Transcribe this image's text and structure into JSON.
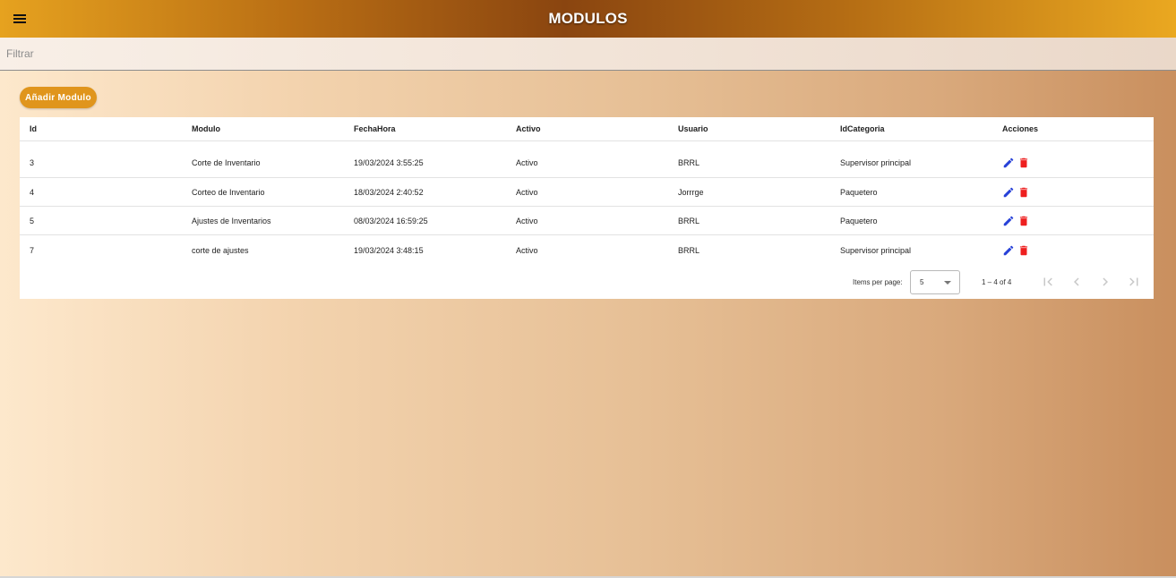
{
  "header": {
    "title": "MODULOS",
    "menu_icon": "menu-icon"
  },
  "filter": {
    "placeholder": "Filtrar",
    "value": ""
  },
  "toolbar": {
    "add_label": "Añadir Modulo"
  },
  "table": {
    "columns": [
      "Id",
      "Modulo",
      "FechaHora",
      "Activo",
      "Usuario",
      "IdCategoria",
      "Acciones"
    ],
    "rows": [
      {
        "id": "3",
        "modulo": "Corte de Inventario",
        "fechahora": "19/03/2024 3:55:25",
        "activo": "Activo",
        "usuario": "BRRL",
        "idcategoria": "Supervisor principal"
      },
      {
        "id": "4",
        "modulo": "Corteo de Inventario",
        "fechahora": "18/03/2024 2:40:52",
        "activo": "Activo",
        "usuario": "Jorrrge",
        "idcategoria": "Paquetero"
      },
      {
        "id": "5",
        "modulo": "Ajustes de Inventarios",
        "fechahora": "08/03/2024 16:59:25",
        "activo": "Activo",
        "usuario": "BRRL",
        "idcategoria": "Paquetero"
      },
      {
        "id": "7",
        "modulo": "corte de ajustes",
        "fechahora": "19/03/2024 3:48:15",
        "activo": "Activo",
        "usuario": "BRRL",
        "idcategoria": "Supervisor principal"
      }
    ],
    "action_icons": [
      "edit-icon",
      "delete-icon"
    ]
  },
  "paginator": {
    "items_per_page_label": "Items per page:",
    "items_per_page_value": "5",
    "range_label": "1 – 4 of 4"
  },
  "colors": {
    "edit": "#2741d8",
    "delete": "#ee1f1f",
    "accent": "#e0951c"
  }
}
